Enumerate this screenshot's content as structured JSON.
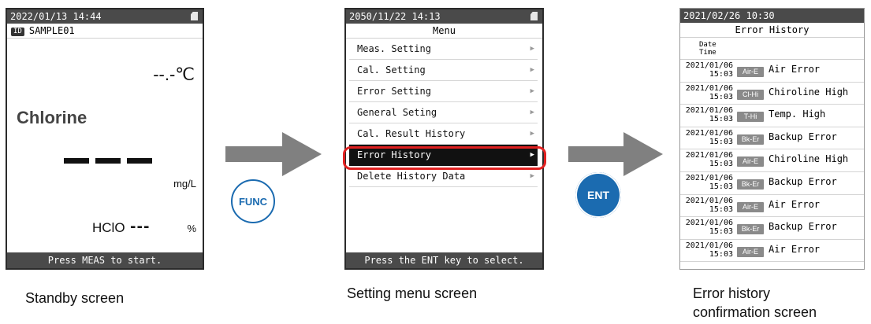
{
  "standby": {
    "datetime": "2022/01/13 14:44",
    "id_badge": "ID",
    "sample_id": "SAMPLE01",
    "temperature": "--.-℃",
    "analyte": "Chlorine",
    "unit": "mg/L",
    "hclo_label": "HClO",
    "hclo_value": "---",
    "hclo_unit": "%",
    "footer": "Press MEAS to start.",
    "caption": "Standby screen"
  },
  "keys": {
    "func": "FUNC",
    "ent": "ENT"
  },
  "menu": {
    "datetime": "2050/11/22 14:13",
    "title": "Menu",
    "items": [
      {
        "label": "Meas. Setting"
      },
      {
        "label": "Cal. Setting"
      },
      {
        "label": "Error Setting"
      },
      {
        "label": "General Seting"
      },
      {
        "label": "Cal. Result History"
      },
      {
        "label": "Error History",
        "selected": true
      },
      {
        "label": "Delete History Data"
      }
    ],
    "footer": "Press the ENT key to select.",
    "caption": "Setting menu screen",
    "chevron": "▶"
  },
  "error_history": {
    "datetime": "2021/02/26 10:30",
    "title": "Error History",
    "header_date": "Date",
    "header_time": "Time",
    "rows": [
      {
        "date": "2021/01/06",
        "time": "15:03",
        "code": "Air-E",
        "text": "Air Error"
      },
      {
        "date": "2021/01/06",
        "time": "15:03",
        "code": "Cl-Hi",
        "text": "Chiroline High"
      },
      {
        "date": "2021/01/06",
        "time": "15:03",
        "code": "T-Hi",
        "text": "Temp. High"
      },
      {
        "date": "2021/01/06",
        "time": "15:03",
        "code": "Bk-Er",
        "text": "Backup Error"
      },
      {
        "date": "2021/01/06",
        "time": "15:03",
        "code": "Air-E",
        "text": "Chiroline High"
      },
      {
        "date": "2021/01/06",
        "time": "15:03",
        "code": "Bk-Er",
        "text": "Backup Error"
      },
      {
        "date": "2021/01/06",
        "time": "15:03",
        "code": "Air-E",
        "text": "Air Error"
      },
      {
        "date": "2021/01/06",
        "time": "15:03",
        "code": "Bk-Er",
        "text": "Backup Error"
      },
      {
        "date": "2021/01/06",
        "time": "15:03",
        "code": "Air-E",
        "text": "Air Error"
      }
    ],
    "caption_line1": "Error history",
    "caption_line2": "confirmation screen"
  },
  "colors": {
    "accent": "#1b6bb0",
    "highlight": "#e02020",
    "arrow": "#808080",
    "bar": "#4a4a4a"
  }
}
